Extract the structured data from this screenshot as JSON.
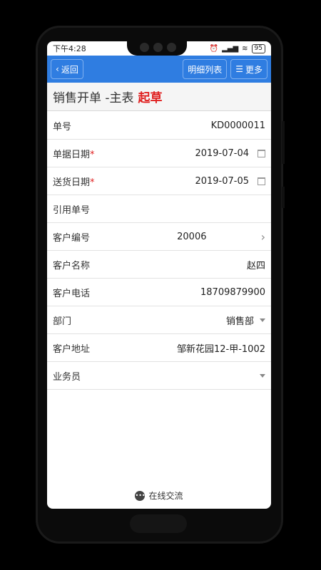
{
  "status_bar": {
    "time": "下午4:28",
    "battery": "95"
  },
  "toolbar": {
    "back_label": "返回",
    "detail_label": "明细列表",
    "more_label": "更多"
  },
  "title": {
    "text": "销售开单 -主表",
    "status": "起草"
  },
  "form": {
    "order_no": {
      "label": "单号",
      "value": "KD0000011"
    },
    "doc_date": {
      "label": "单据日期",
      "value": "2019-07-04"
    },
    "delivery_date": {
      "label": "送货日期",
      "value": "2019-07-05"
    },
    "ref_no": {
      "label": "引用单号",
      "value": ""
    },
    "customer_code": {
      "label": "客户编号",
      "value": "20006"
    },
    "customer_name": {
      "label": "客户名称",
      "value": "赵四"
    },
    "customer_phone": {
      "label": "客户电话",
      "value": "18709879900"
    },
    "department": {
      "label": "部门",
      "value": "销售部"
    },
    "customer_address": {
      "label": "客户地址",
      "value": "邹新花园12-甲-1002"
    },
    "salesman": {
      "label": "业务员",
      "value": ""
    }
  },
  "footer": {
    "chat_label": "在线交流"
  },
  "colors": {
    "accent": "#2f7de1",
    "draft": "#e02020"
  }
}
